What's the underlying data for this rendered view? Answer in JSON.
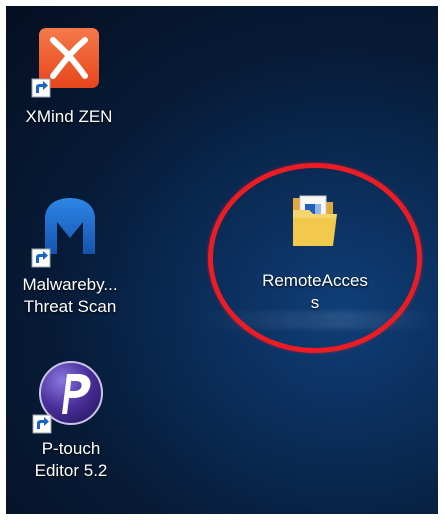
{
  "desktop": {
    "icons": [
      {
        "label_lines": [
          "XMind ZEN"
        ],
        "icon": "xmind-x-icon",
        "shortcut": true
      },
      {
        "label_lines": [
          "Malwareby...",
          "Threat Scan"
        ],
        "icon": "malwarebytes-m-icon",
        "shortcut": true
      },
      {
        "label_lines": [
          "P-touch",
          "Editor 5.2"
        ],
        "icon": "ptouch-p-icon",
        "shortcut": true
      },
      {
        "label_lines": [
          "RemoteAcces",
          "s"
        ],
        "icon": "folder-icon",
        "shortcut": false
      }
    ]
  },
  "colors": {
    "highlight_ring": "#ec1c24",
    "xmind_tile": "#f05a28",
    "malwarebytes_blue": "#1f6fd0",
    "ptouch_purple": "#4a2f9a",
    "folder_yellow": "#f2c94c"
  }
}
